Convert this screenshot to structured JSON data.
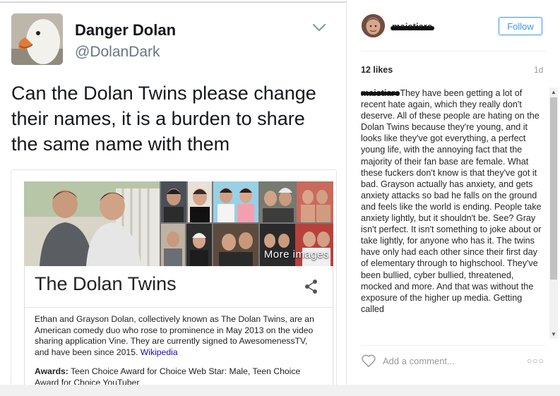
{
  "tweet": {
    "display_name": "Danger Dolan",
    "handle": "@DolanDark",
    "text": "Can the Dolan Twins please change their names, it is a burden to share the same name with them",
    "card": {
      "more_images": "More images",
      "title": "The Dolan Twins",
      "description_prefix": "Ethan and Grayson Dolan, collectively known as The Dolan Twins, are an American comedy duo who rose to prominence in May 2013 on the video sharing application Vine. They are currently signed to AwesomenessTV, and have been since 2015.",
      "description_link": "Wikipedia",
      "awards_label": "Awards:",
      "awards_text": "Teen Choice Award for Choice Web Star: Male, Teen Choice Award for Choice YouTuber"
    }
  },
  "instagram": {
    "username": "maistiare",
    "follow_label": "Follow",
    "likes": "12 likes",
    "time_ago": "1d",
    "caption_user": "maistiare",
    "caption_text": "They have been getting a lot of recent hate again, which they really don't deserve. All of these people are hating on the Dolan Twins because they're young, and it looks like they've got everything, a perfect young life, with the annoying fact that the majority of their fan base are female. What these fuckers don't know is that they've got it bad. Grayson actually has anxiety, and gets anxiety attacks so bad he falls on the ground and feels like the world is ending. People take anxiety lightly, but it shouldn't be. See? Gray isn't perfect. It isn't something to joke about or take lightly, for anyone who has it. The twins have only had each other since their first day of elementary through to highschool. They've been bullied, cyber bullied, threatened, mocked and more. And that was without the exposure of the higher up media. Getting called",
    "comment_placeholder": "Add a comment...",
    "more_icon": "ellipsis-icon",
    "heart_icon": "heart-icon"
  },
  "colors": {
    "twitter_text": "#14171a",
    "twitter_secondary": "#657786",
    "instagram_blue": "#3897f0",
    "link_blue": "#1a0dab"
  }
}
